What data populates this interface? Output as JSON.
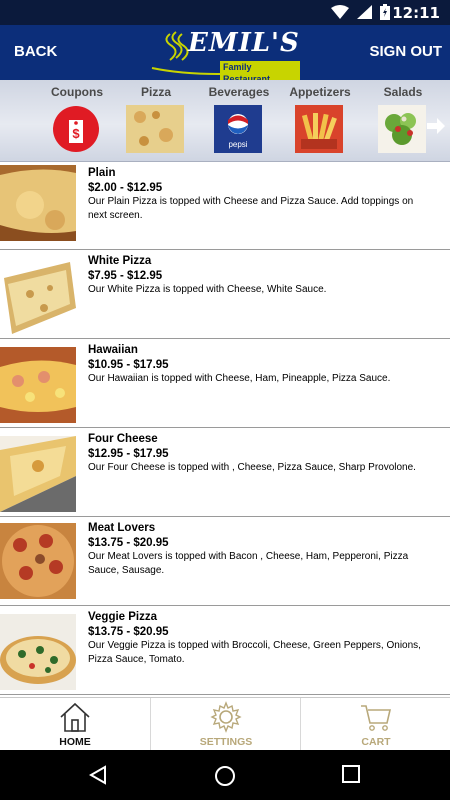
{
  "status": {
    "time": "12:11"
  },
  "header": {
    "back_label": "BACK",
    "signout_label": "SIGN OUT",
    "logo_name": "EMIL'S",
    "logo_sub": "Family Restaurant"
  },
  "categories": [
    {
      "label": "Coupons",
      "icon": "coupon-icon"
    },
    {
      "label": "Pizza",
      "icon": "pizza-image"
    },
    {
      "label": "Beverages",
      "icon": "pepsi-icon"
    },
    {
      "label": "Appetizers",
      "icon": "fries-image"
    },
    {
      "label": "Salads",
      "icon": "salad-image"
    }
  ],
  "items": [
    {
      "title": "Plain",
      "price": "$2.00 - $12.95",
      "desc": "Our Plain Pizza is topped with Cheese and Pizza Sauce.  Add toppings on next screen."
    },
    {
      "title": "White Pizza",
      "price": "$7.95 - $12.95",
      "desc": "Our White Pizza is topped with Cheese, White Sauce."
    },
    {
      "title": "Hawaiian",
      "price": "$10.95 - $17.95",
      "desc": "Our Hawaiian is topped with Cheese, Ham, Pineapple, Pizza Sauce."
    },
    {
      "title": "Four Cheese",
      "price": "$12.95 - $17.95",
      "desc": "Our Four Cheese is topped with , Cheese, Pizza Sauce, Sharp Provolone."
    },
    {
      "title": "Meat Lovers",
      "price": "$13.75 - $20.95",
      "desc": "Our Meat Lovers is topped with Bacon , Cheese, Ham, Pepperoni, Pizza Sauce, Sausage."
    },
    {
      "title": "Veggie Pizza",
      "price": "$13.75 - $20.95",
      "desc": "Our Veggie Pizza is topped with Broccoli, Cheese, Green Peppers, Onions, Pizza Sauce, Tomato."
    }
  ],
  "tabs": [
    {
      "label": "HOME",
      "icon": "home-icon",
      "active": true
    },
    {
      "label": "SETTINGS",
      "icon": "gear-icon",
      "active": false
    },
    {
      "label": "CART",
      "icon": "cart-icon",
      "active": false
    }
  ],
  "colors": {
    "header_bg": "#0c2e7a",
    "accent_green": "#c8d400",
    "inactive_tab": "#b8a87a"
  }
}
